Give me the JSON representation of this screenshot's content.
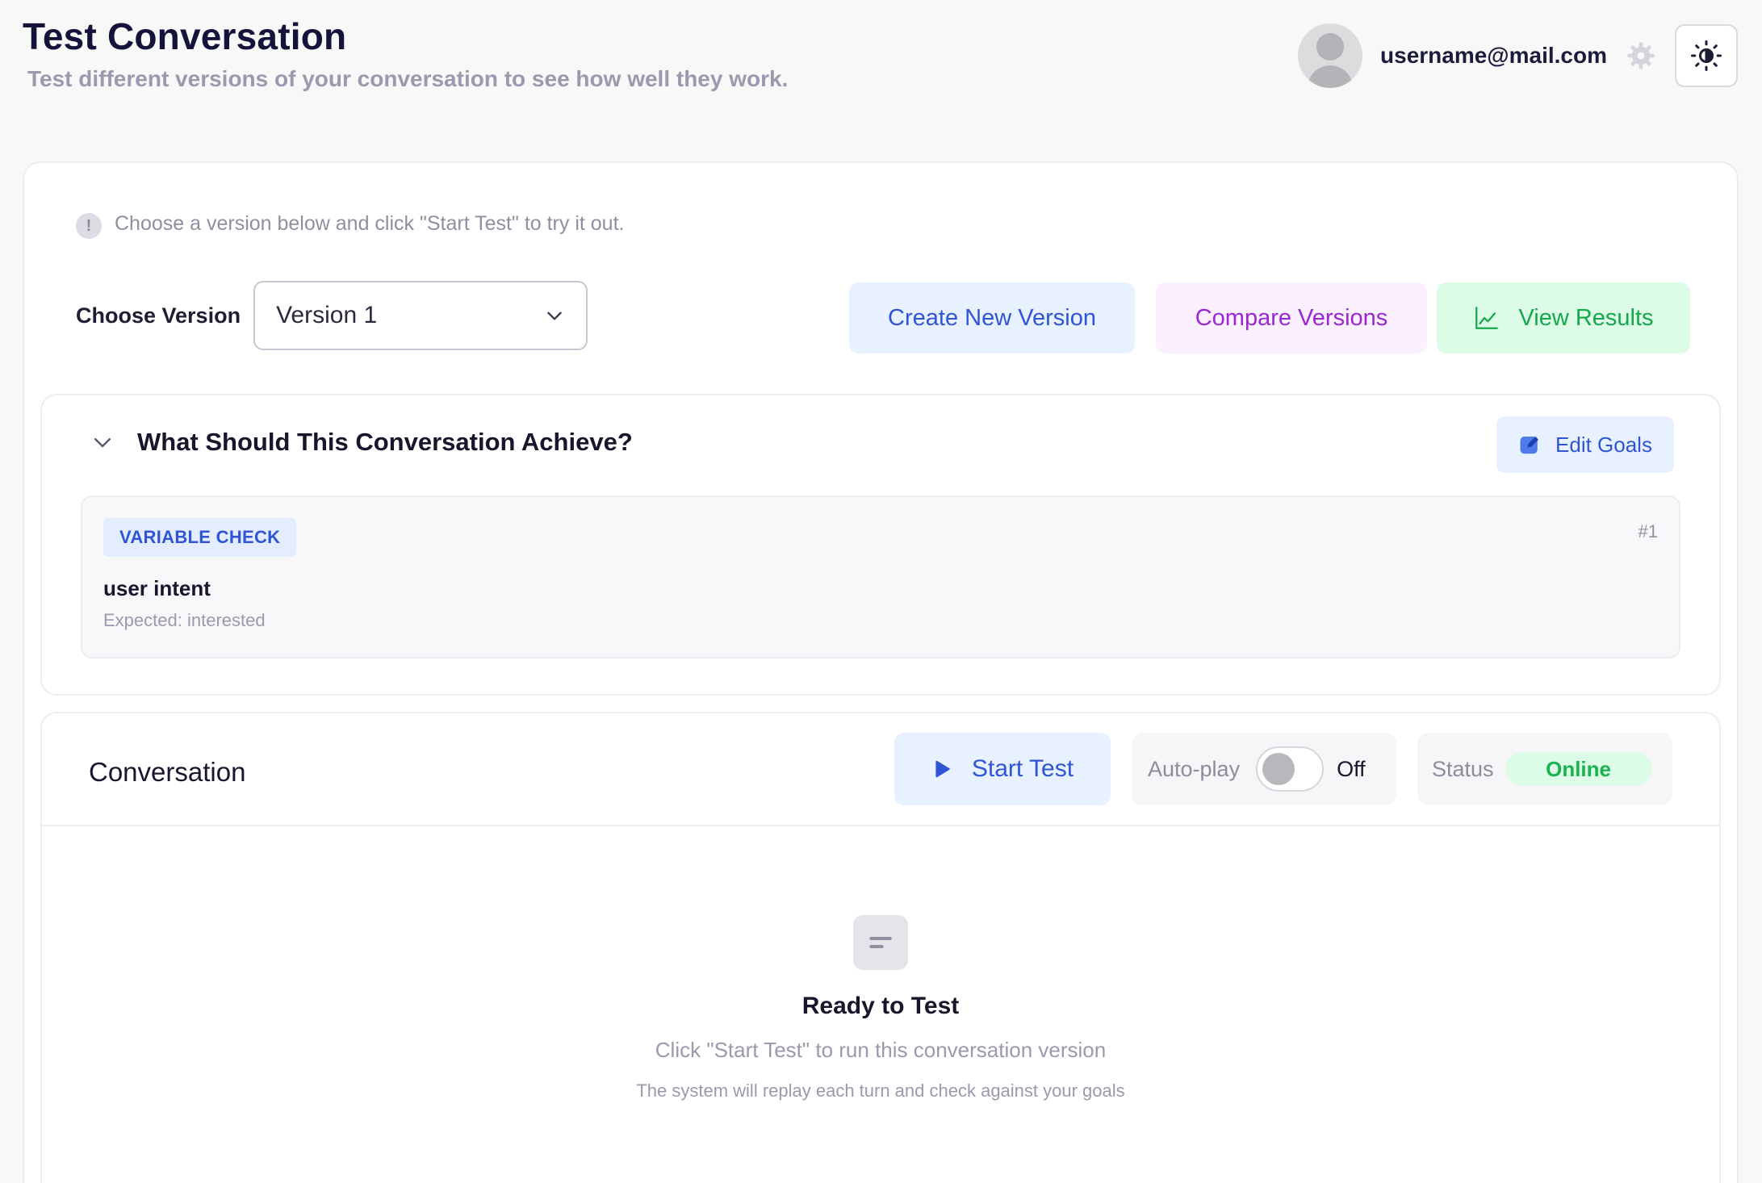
{
  "header": {
    "title": "Test Conversation",
    "subtitle": "Test different versions of your conversation to see how well they work."
  },
  "user": {
    "email": "username@mail.com",
    "avatar_icon": "user-avatar-icon",
    "settings_icon": "gear-icon",
    "theme_icon": "sun-icon"
  },
  "main": {
    "hint": "Choose a version below and click \"Start Test\" to try it out.",
    "version_label": "Choose Version",
    "version_selected": "Version 1",
    "buttons": {
      "create": "Create New Version",
      "compare": "Compare Versions",
      "results": "View Results"
    }
  },
  "goals": {
    "title": "What Should This Conversation Achieve?",
    "edit_label": "Edit Goals",
    "items": [
      {
        "type": "VARIABLE CHECK",
        "number": "#1",
        "name": "user intent",
        "expected_label": "Expected:",
        "expected_value": "interested"
      }
    ]
  },
  "conversation": {
    "title": "Conversation",
    "start_label": "Start Test",
    "autoplay_label": "Auto-play",
    "autoplay_state": "Off",
    "status_label": "Status",
    "status_value": "Online",
    "empty_title": "Ready to Test",
    "empty_subtitle": "Click \"Start Test\" to run this conversation version",
    "empty_note": "The system will replay each turn and check against your goals"
  },
  "colors": {
    "accent_blue": "#2f55d4",
    "accent_purple": "#9b27d1",
    "accent_green": "#15a84a"
  }
}
